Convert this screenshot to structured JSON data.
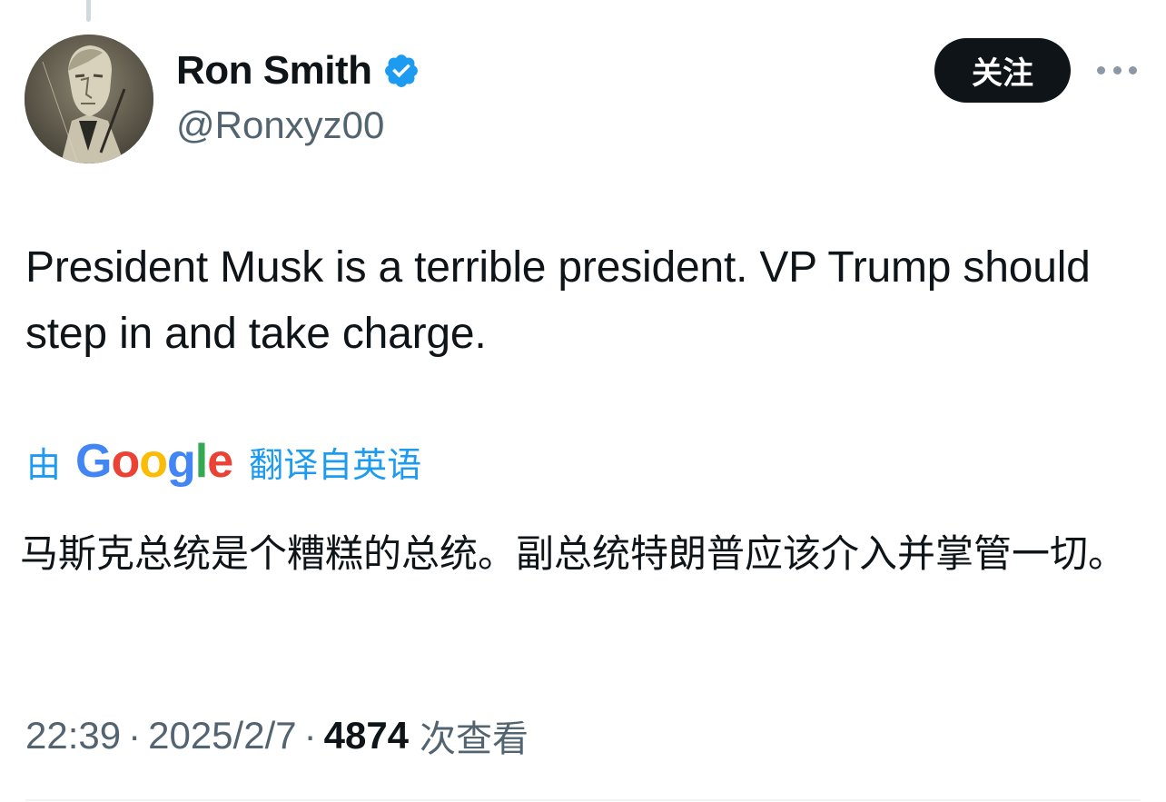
{
  "author": {
    "display_name": "Ron Smith",
    "handle": "@Ronxyz00",
    "verified": true,
    "verified_icon": "verified-badge-icon",
    "verified_color": "#1d9bf0"
  },
  "actions": {
    "follow_label": "关注",
    "more_icon": "more-horizontal-icon"
  },
  "tweet": {
    "text": "President Musk is a terrible president. VP Trump should step in and take charge."
  },
  "translation": {
    "prefix": "由",
    "provider": "Google",
    "suffix": "翻译自英语",
    "text": "马斯克总统是个糟糕的总统。副总统特朗普应该介入并掌管一切。"
  },
  "meta": {
    "time": "22:39",
    "date": "2025/2/7",
    "separator": "·",
    "view_count": "4874",
    "views_label": "次查看"
  },
  "colors": {
    "accent": "#1d9bf0",
    "text_primary": "#0f1419",
    "text_secondary": "#536471",
    "button_bg": "#0f1419"
  }
}
